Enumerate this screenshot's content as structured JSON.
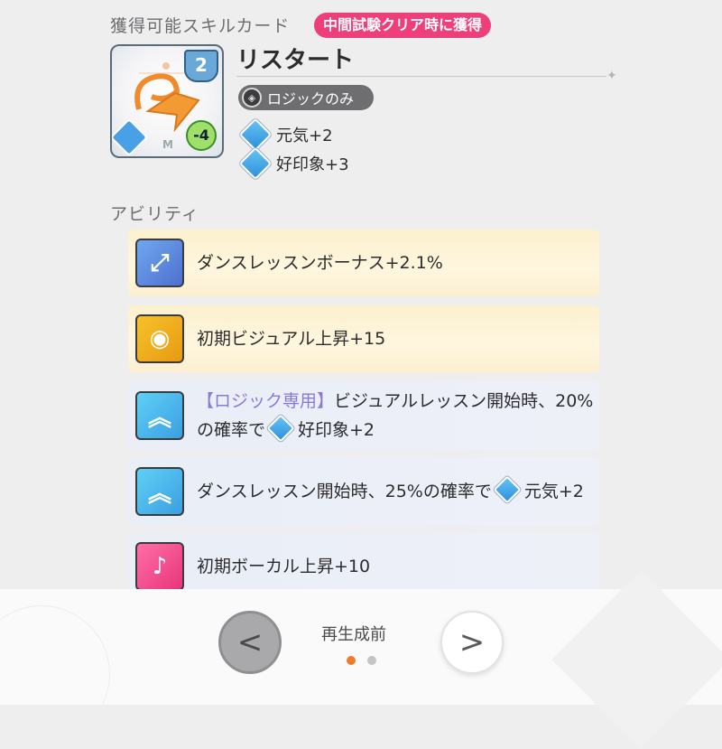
{
  "header": {
    "section_title": "獲得可能スキルカード",
    "badge": "中間試験クリア時に獲得"
  },
  "card": {
    "cost": "2",
    "stamina": "-4",
    "art_letter": "M",
    "name": "リスタート",
    "tag": "ロジックのみ",
    "effects": [
      {
        "icon": "genki-icon",
        "text": "元気+2"
      },
      {
        "icon": "good-impression-icon",
        "text": "好印象+3"
      }
    ]
  },
  "abilities": {
    "title": "アビリティ",
    "items": [
      {
        "icon": "dance-lesson-icon",
        "style": "gold",
        "text": "ダンスレッスンボーナス+2.1%"
      },
      {
        "icon": "visual-icon",
        "style": "gold",
        "text": "初期ビジュアル上昇+15"
      },
      {
        "icon": "skill-trigger-icon",
        "style": "blue",
        "prefix": "【ロジック専用】",
        "text_a": "ビジュアルレッスン開始時、20%の確率で",
        "text_b": "好印象+2"
      },
      {
        "icon": "skill-trigger-icon",
        "style": "blue",
        "text_a": "ダンスレッスン開始時、25%の確率で",
        "text_b": "元気+2"
      },
      {
        "icon": "vocal-icon",
        "style": "blue",
        "text": "初期ボーカル上昇+10"
      }
    ]
  },
  "footer": {
    "state_label": "再生成前",
    "prev_icon": "chevron-left-icon",
    "next_icon": "chevron-right-icon",
    "page_indicator": {
      "current": 1,
      "total": 2
    },
    "colors": {
      "active_dot": "#f07a2c",
      "inactive_dot": "#c4c4c6"
    }
  },
  "colors": {
    "badge": "#ee3f7b",
    "logic_text": "#8a79d8"
  }
}
